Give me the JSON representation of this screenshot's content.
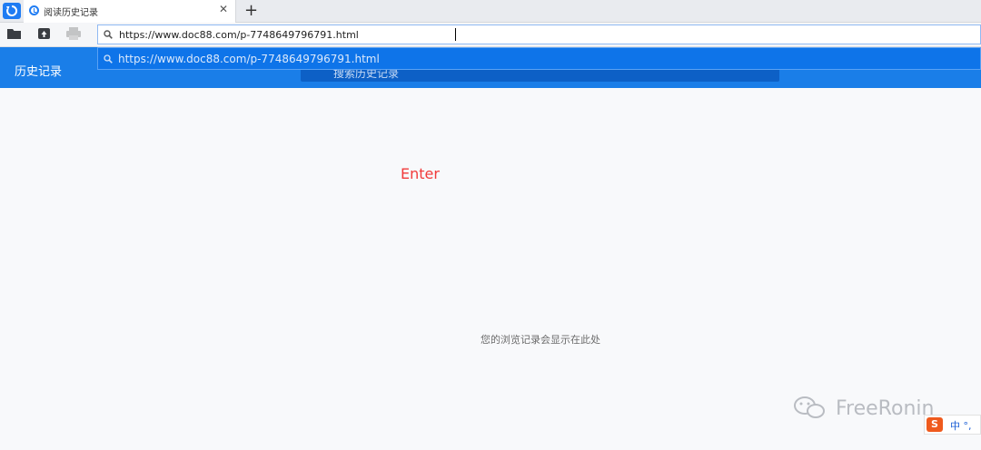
{
  "tab": {
    "title": "阅读历史记录"
  },
  "address_bar": {
    "url": "https://www.doc88.com/p-7748649796791.html"
  },
  "header": {
    "title": "历史记录",
    "search_placeholder": "搜索历史记录"
  },
  "suggestion": {
    "url": "https://www.doc88.com/p-7748649796791.html"
  },
  "annotation": {
    "text": "Enter"
  },
  "main": {
    "empty_message": "您的浏览记录会显示在此处"
  },
  "watermark": {
    "text": "FreeRonin"
  },
  "ime": {
    "logo": "S",
    "text": "中 °,"
  },
  "colors": {
    "accent": "#1a7ee8",
    "annotation": "#f13a3a",
    "suggestion_bg": "#0e74e9"
  }
}
